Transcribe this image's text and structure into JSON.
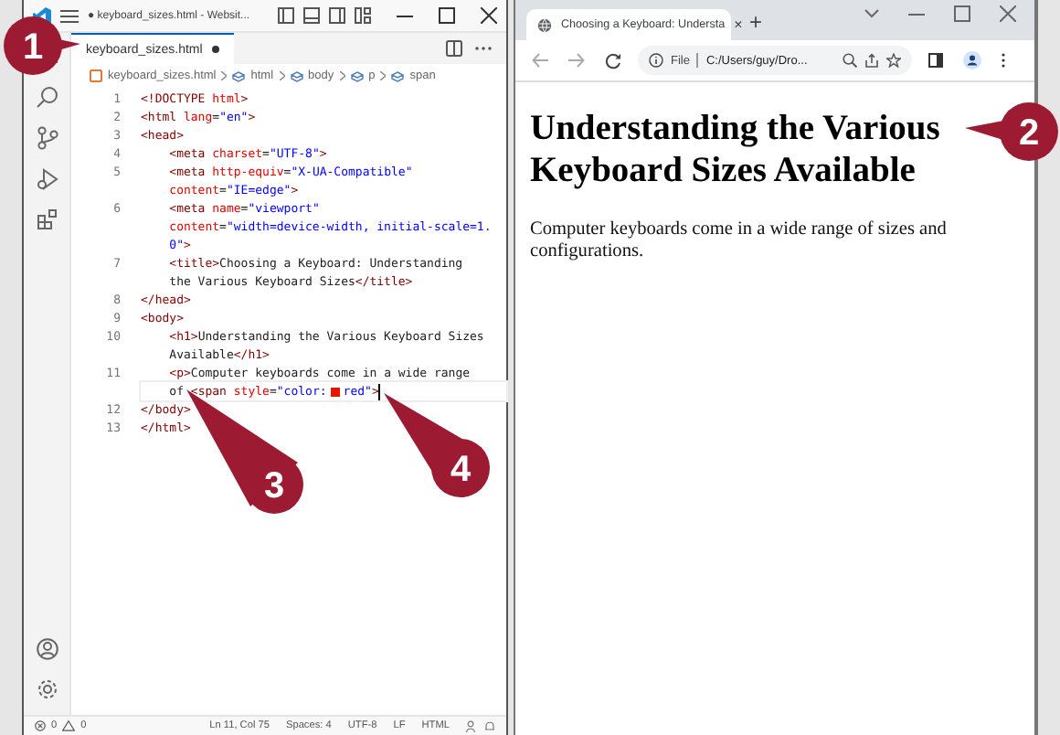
{
  "editor_window": {
    "title": "● keyboard_sizes.html - Websit...",
    "tab": {
      "label": "keyboard_sizes.html",
      "modified": true,
      "selected": true
    },
    "breadcrumb": [
      "keyboard_sizes.html",
      "html",
      "body",
      "p",
      "span"
    ],
    "code_rows": [
      {
        "number": "1",
        "cursor": false,
        "tokens": [
          {
            "kind": "tag",
            "text": "<!DOCTYPE "
          },
          {
            "kind": "attr",
            "text": "html"
          },
          {
            "kind": "tag",
            "text": ">"
          }
        ]
      },
      {
        "number": "2",
        "cursor": false,
        "tokens": [
          {
            "kind": "tag",
            "text": "<html "
          },
          {
            "kind": "attr",
            "text": "lang"
          },
          {
            "kind": "text",
            "text": "="
          },
          {
            "kind": "value",
            "text": "\"en\""
          },
          {
            "kind": "tag",
            "text": ">"
          }
        ]
      },
      {
        "number": "3",
        "cursor": false,
        "tokens": [
          {
            "kind": "tag",
            "text": "<head>"
          }
        ]
      },
      {
        "number": "4",
        "cursor": false,
        "tokens": [
          {
            "kind": "tag",
            "text": "    <meta "
          },
          {
            "kind": "attr",
            "text": "charset"
          },
          {
            "kind": "text",
            "text": "="
          },
          {
            "kind": "value",
            "text": "\"UTF-8\""
          },
          {
            "kind": "tag",
            "text": ">"
          }
        ]
      },
      {
        "number": "5",
        "cursor": false,
        "tokens": [
          {
            "kind": "tag",
            "text": "    <meta "
          },
          {
            "kind": "attr",
            "text": "http-equiv"
          },
          {
            "kind": "text",
            "text": "="
          },
          {
            "kind": "value",
            "text": "\"X-UA-Compatible\""
          }
        ]
      },
      {
        "cursor": false,
        "tokens": [
          {
            "kind": "attr",
            "text": "    content"
          },
          {
            "kind": "text",
            "text": "="
          },
          {
            "kind": "value",
            "text": "\"IE=edge\""
          },
          {
            "kind": "tag",
            "text": ">"
          }
        ]
      },
      {
        "number": "6",
        "cursor": false,
        "tokens": [
          {
            "kind": "tag",
            "text": "    <meta "
          },
          {
            "kind": "attr",
            "text": "name"
          },
          {
            "kind": "text",
            "text": "="
          },
          {
            "kind": "value",
            "text": "\"viewport\""
          }
        ]
      },
      {
        "cursor": false,
        "tokens": [
          {
            "kind": "attr",
            "text": "    content"
          },
          {
            "kind": "text",
            "text": "="
          },
          {
            "kind": "value",
            "text": "\"width=device-width, initial-scale=1."
          }
        ]
      },
      {
        "cursor": false,
        "tokens": [
          {
            "kind": "value",
            "text": "    0\""
          },
          {
            "kind": "tag",
            "text": ">"
          }
        ]
      },
      {
        "number": "7",
        "cursor": false,
        "tokens": [
          {
            "kind": "tag",
            "text": "    <title>"
          },
          {
            "kind": "text",
            "text": "Choosing a Keyboard: Understanding"
          }
        ]
      },
      {
        "cursor": false,
        "tokens": [
          {
            "kind": "text",
            "text": "    the Various Keyboard Sizes"
          },
          {
            "kind": "tag",
            "text": "</title>"
          }
        ]
      },
      {
        "number": "8",
        "cursor": false,
        "tokens": [
          {
            "kind": "tag",
            "text": "</head>"
          }
        ]
      },
      {
        "number": "9",
        "cursor": false,
        "tokens": [
          {
            "kind": "tag",
            "text": "<body>"
          }
        ]
      },
      {
        "number": "10",
        "cursor": false,
        "tokens": [
          {
            "kind": "tag",
            "text": "    <h1>"
          },
          {
            "kind": "text",
            "text": "Understanding the Various Keyboard Sizes"
          }
        ]
      },
      {
        "cursor": false,
        "tokens": [
          {
            "kind": "text",
            "text": "    Available"
          },
          {
            "kind": "tag",
            "text": "</h1>"
          }
        ]
      },
      {
        "number": "11",
        "cursor": false,
        "tokens": [
          {
            "kind": "tag",
            "text": "    <p>"
          },
          {
            "kind": "text",
            "text": "Computer keyboards come in a wide range"
          }
        ]
      },
      {
        "cursor": true,
        "tokens": [
          {
            "kind": "text",
            "text": "    of "
          },
          {
            "kind": "tag",
            "text": "<span "
          },
          {
            "kind": "attr",
            "text": "style"
          },
          {
            "kind": "text",
            "text": "="
          },
          {
            "kind": "value",
            "text": "\"color:"
          },
          {
            "kind": "swatch",
            "color": "#e51400"
          },
          {
            "kind": "value",
            "text": "red\""
          },
          {
            "kind": "tag",
            "text": ">"
          }
        ]
      },
      {
        "number": "12",
        "cursor": false,
        "tokens": [
          {
            "kind": "tag",
            "text": "</body>"
          }
        ]
      },
      {
        "number": "13",
        "cursor": false,
        "tokens": [
          {
            "kind": "tag",
            "text": "</html>"
          }
        ]
      }
    ],
    "status_bar": {
      "problems": "0",
      "warnings": "0",
      "items": [
        "Ln 11, Col 75",
        "Spaces: 4",
        "UTF-8",
        "LF",
        "HTML"
      ]
    }
  },
  "browser_window": {
    "tab": {
      "title": "Choosing a Keyboard: Understa",
      "close": "×",
      "selected": true
    },
    "new_tab": "+",
    "address": {
      "scheme": "File",
      "path": "C:/Users/guy/Dro..."
    },
    "page": {
      "heading": "Understanding the Various Keyboard Sizes Available",
      "paragraph": "Computer keyboards come in a wide range of sizes and configurations."
    }
  },
  "callouts": [
    {
      "number": "1"
    },
    {
      "number": "2"
    },
    {
      "number": "3"
    },
    {
      "number": "4"
    }
  ]
}
